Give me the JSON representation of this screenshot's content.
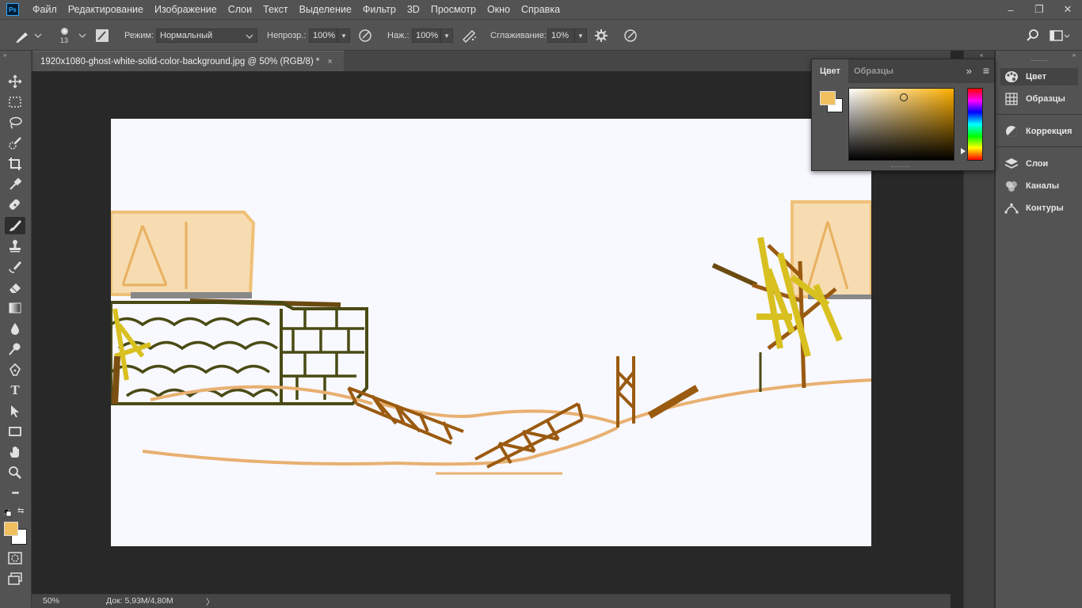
{
  "app": {
    "logo": "Ps"
  },
  "menu": [
    "Файл",
    "Редактирование",
    "Изображение",
    "Слои",
    "Текст",
    "Выделение",
    "Фильтр",
    "3D",
    "Просмотр",
    "Окно",
    "Справка"
  ],
  "window_controls": {
    "minimize": "–",
    "restore": "❐",
    "close": "✕"
  },
  "options": {
    "brush_size": "13",
    "mode_label": "Режим:",
    "mode_value": "Нормальный",
    "opacity_label": "Непрозр.:",
    "opacity_value": "100%",
    "flow_label": "Наж.:",
    "flow_value": "100%",
    "smoothing_label": "Сглаживание:",
    "smoothing_value": "10%"
  },
  "document": {
    "tab_title": "1920x1080-ghost-white-solid-color-background.jpg @ 50% (RGB/8) *",
    "close": "×",
    "canvas_color": "#f8f8ff"
  },
  "status": {
    "zoom": "50%",
    "doc_size": "Док: 5,93M/4,80M",
    "arrow": "〉"
  },
  "colors": {
    "foreground": "#f0c060",
    "background": "#ffffff",
    "ui_dark": "#282828",
    "ui_mid": "#535353"
  },
  "color_panel": {
    "tabs": [
      "Цвет",
      "Образцы"
    ],
    "collapse": "»",
    "menu": "≡"
  },
  "dock": {
    "items": [
      {
        "label": "Цвет",
        "icon": "palette-icon"
      },
      {
        "label": "Образцы",
        "icon": "swatches-grid-icon"
      },
      {
        "label": "Коррекция",
        "icon": "adjustments-icon"
      },
      {
        "label": "Слои",
        "icon": "layers-icon"
      },
      {
        "label": "Каналы",
        "icon": "channels-icon"
      },
      {
        "label": "Контуры",
        "icon": "paths-icon"
      }
    ]
  },
  "tools": [
    {
      "name": "move-tool"
    },
    {
      "name": "marquee-tool"
    },
    {
      "name": "lasso-tool"
    },
    {
      "name": "quick-selection-tool"
    },
    {
      "name": "crop-tool"
    },
    {
      "name": "eyedropper-tool"
    },
    {
      "name": "healing-brush-tool"
    },
    {
      "name": "brush-tool"
    },
    {
      "name": "clone-stamp-tool"
    },
    {
      "name": "history-brush-tool"
    },
    {
      "name": "eraser-tool"
    },
    {
      "name": "gradient-tool"
    },
    {
      "name": "blur-tool"
    },
    {
      "name": "dodge-tool"
    },
    {
      "name": "pen-tool"
    },
    {
      "name": "type-tool"
    },
    {
      "name": "path-selection-tool"
    },
    {
      "name": "rectangle-tool"
    },
    {
      "name": "hand-tool"
    },
    {
      "name": "zoom-tool"
    },
    {
      "name": "edit-toolbar"
    }
  ],
  "tool_glyphs": {
    "type": "T",
    "more": "•••"
  }
}
